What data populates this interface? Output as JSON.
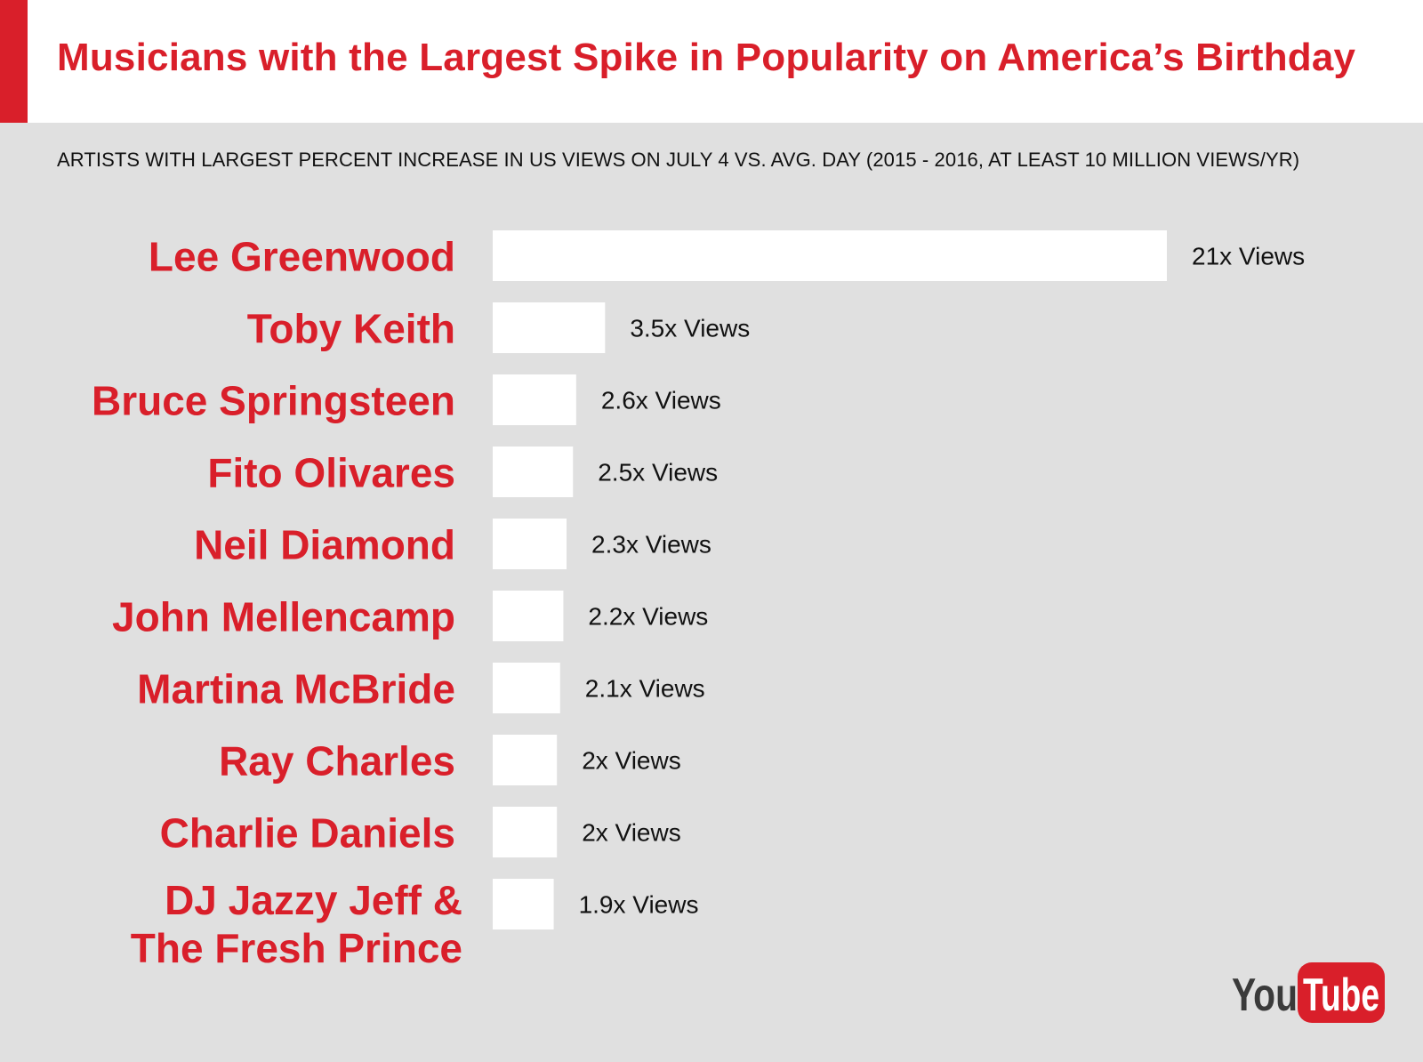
{
  "colors": {
    "accent": "#d91f2a",
    "background": "#e0e0e0",
    "header_bg": "#ffffff",
    "bar": "#ffffff",
    "value_text": "#111111"
  },
  "title": "Musicians with the Largest Spike in Popularity on America’s Birthday",
  "subtitle": "ARTISTS WITH LARGEST PERCENT INCREASE IN US VIEWS ON JULY 4 VS. AVG. DAY (2015 - 2016,  AT LEAST 10 MILLION VIEWS/YR)",
  "logo": {
    "part1": "You",
    "part2": "Tube",
    "icon": "youtube-logo"
  },
  "chart_data": {
    "type": "bar",
    "orientation": "horizontal",
    "title": "Musicians with the Largest Spike in Popularity on America’s Birthday",
    "subtitle": "ARTISTS WITH LARGEST PERCENT INCREASE IN US VIEWS ON JULY 4 VS. AVG. DAY (2015 - 2016,  AT LEAST 10 MILLION VIEWS/YR)",
    "xlabel": "",
    "ylabel": "",
    "grid": false,
    "legend": "none",
    "xlim": [
      0,
      21
    ],
    "categories": [
      "Lee Greenwood",
      "Toby Keith",
      "Bruce Springsteen",
      "Fito Olivares",
      "Neil Diamond",
      "John Mellencamp",
      "Martina McBride",
      "Ray Charles",
      "Charlie Daniels",
      "DJ Jazzy Jeff & The Fresh Prince"
    ],
    "values": [
      21,
      3.5,
      2.6,
      2.5,
      2.3,
      2.2,
      2.1,
      2,
      2,
      1.9
    ],
    "data_labels": [
      "21x Views",
      "3.5x Views",
      "2.6x Views",
      "2.5x Views",
      "2.3x Views",
      "2.2x Views",
      "2.1x Views",
      "2x Views",
      "2x Views",
      "1.9x Views"
    ]
  }
}
